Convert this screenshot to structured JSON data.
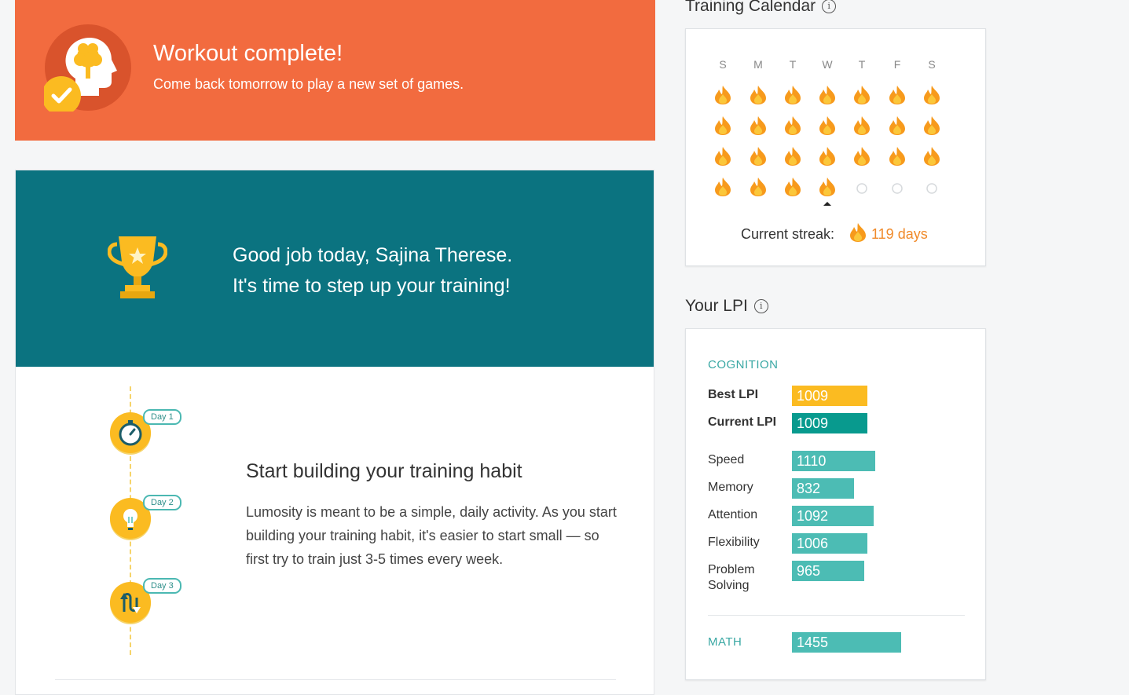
{
  "banner": {
    "title": "Workout complete!",
    "subtitle": "Come back tomorrow to play a new set of games.",
    "bg_color": "#f26b3f"
  },
  "encouragement": {
    "line1": "Good job today, Sajina Therese.",
    "line2": "It's time to step up your training!",
    "bg_color": "#0b7380"
  },
  "habit": {
    "title": "Start building your training habit",
    "body": "Lumosity is meant to be a simple, daily activity. As you start building your training habit, it's easier to start small — so first try to train just 3-5 times every week.",
    "days": [
      {
        "label": "Day 1",
        "icon": "stopwatch-icon"
      },
      {
        "label": "Day 2",
        "icon": "lightbulb-icon"
      },
      {
        "label": "Day 3",
        "icon": "u-turn-arrows-icon"
      }
    ]
  },
  "calendar": {
    "title": "Training Calendar",
    "weekdays": [
      "S",
      "M",
      "T",
      "W",
      "T",
      "F",
      "S"
    ],
    "weeks": [
      [
        "flame",
        "flame",
        "flame",
        "flame",
        "flame",
        "flame",
        "flame"
      ],
      [
        "flame",
        "flame",
        "flame",
        "flame",
        "flame",
        "flame",
        "flame"
      ],
      [
        "flame",
        "flame",
        "flame",
        "flame",
        "flame",
        "flame",
        "flame"
      ],
      [
        "flame",
        "flame",
        "flame",
        "flame",
        "empty",
        "empty",
        "empty"
      ]
    ],
    "today_col": 3,
    "streak_label": "Current streak:",
    "streak_value": "119 days",
    "flame_color": "#f79a1c"
  },
  "lpi": {
    "title": "Your LPI",
    "cognition_label": "COGNITION",
    "best": {
      "label": "Best LPI",
      "value": 1009,
      "color": "#fbbb21"
    },
    "current": {
      "label": "Current LPI",
      "value": 1009,
      "color": "#089a8e"
    },
    "areas": [
      {
        "label": "Speed",
        "value": 1110
      },
      {
        "label": "Memory",
        "value": 832
      },
      {
        "label": "Attention",
        "value": 1092
      },
      {
        "label": "Flexibility",
        "value": 1006
      },
      {
        "label": "Problem Solving",
        "value": 965
      }
    ],
    "math": {
      "label": "MATH",
      "value": 1455
    },
    "area_color": "#4cbcb4"
  }
}
